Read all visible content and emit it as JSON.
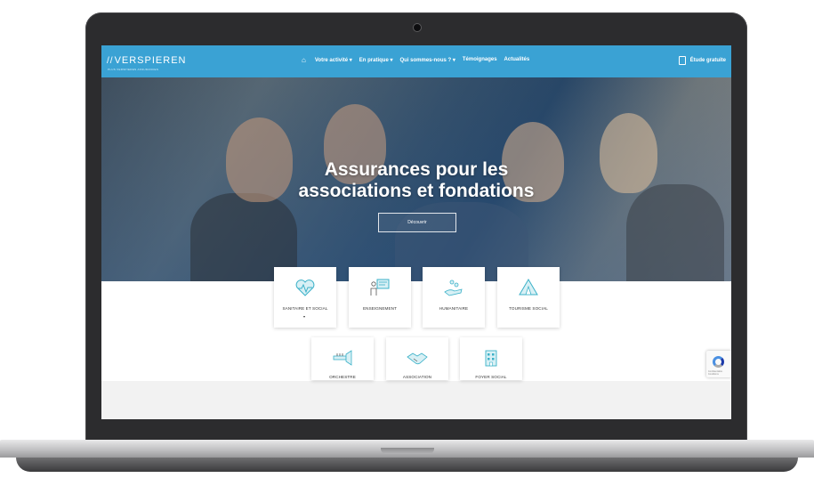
{
  "header": {
    "logo_text": "VERSPIEREN",
    "logo_mark": "//",
    "logo_subtitle": "PLUS VERSPIEREN ASSURANCES",
    "menu": [
      {
        "label": "Votre activité",
        "has_dropdown": true
      },
      {
        "label": "En pratique",
        "has_dropdown": true
      },
      {
        "label": "Qui sommes-nous ?",
        "has_dropdown": true
      },
      {
        "label": "Témoignages",
        "has_dropdown": false
      },
      {
        "label": "Actualités",
        "has_dropdown": false
      }
    ],
    "dropdown_glyph": "▾",
    "home_icon": "home-icon",
    "cta_label": "Étude gratuite",
    "cta_icon": "document-icon",
    "bg_color": "#3aa2d4"
  },
  "hero": {
    "title_line1": "Assurances pour les",
    "title_line2": "associations et fondations",
    "button_label": "Découvrir"
  },
  "categories_row1": [
    {
      "label": "SANITAIRE ET SOCIAL",
      "icon": "heart-pulse-icon",
      "caret": "▾"
    },
    {
      "label": "ENSEIGNEMENT",
      "icon": "teacher-board-icon"
    },
    {
      "label": "HUMANITAIRE",
      "icon": "helping-hand-icon"
    },
    {
      "label": "TOURISME SOCIAL",
      "icon": "tent-icon"
    }
  ],
  "categories_row2": [
    {
      "label": "ORCHESTRE",
      "icon": "trumpet-icon"
    },
    {
      "label": "ASSOCIATION",
      "icon": "handshake-icon"
    },
    {
      "label": "FOYER SOCIAL",
      "icon": "building-icon"
    }
  ],
  "recaptcha": {
    "text": "Confidentialité · Conditions"
  },
  "colors": {
    "accent": "#3aa2d4",
    "icon_teal": "#3bb1c8",
    "laptop_frame": "#2c2c2e"
  }
}
